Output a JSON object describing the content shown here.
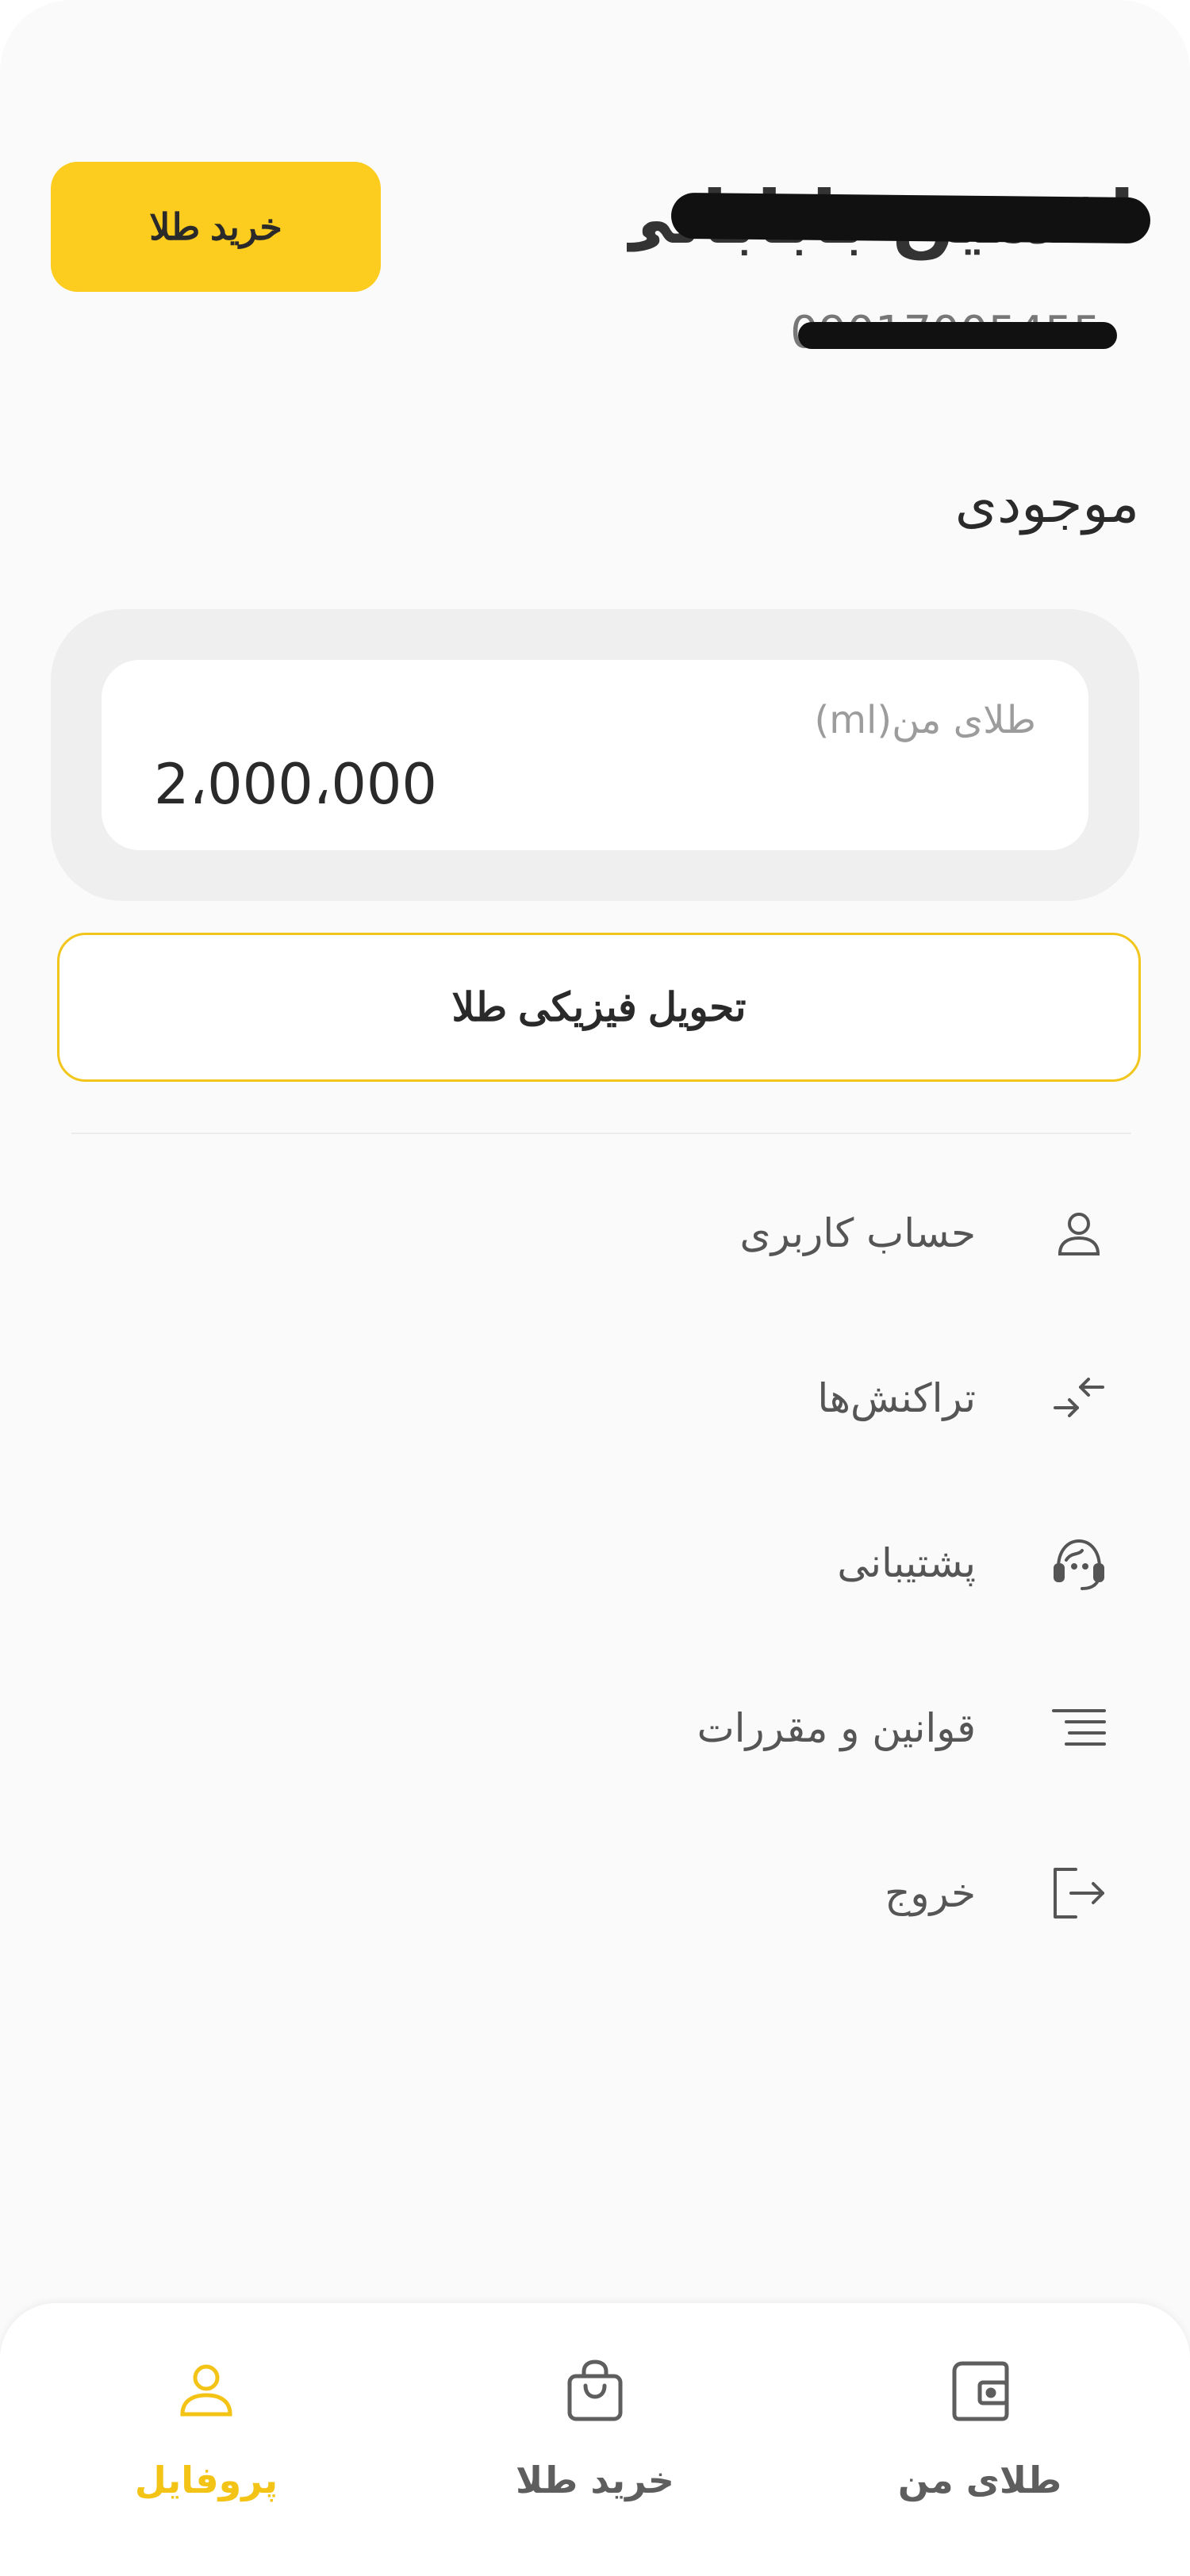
{
  "header": {
    "buy_button_label": "خرید طلا",
    "user_name": "افشین بابابانی",
    "user_phone": "09017005455"
  },
  "balance": {
    "title": "موجودی",
    "label": "طلای من(ml)",
    "value": "2،000،000"
  },
  "delivery_button_label": "تحویل فیزیکی طلا",
  "menu": {
    "items": [
      {
        "label": "حساب کاربری",
        "icon": "user-icon"
      },
      {
        "label": "تراکنش‌ها",
        "icon": "transactions-arrows-icon"
      },
      {
        "label": "پشتیبانی",
        "icon": "support-headset-icon"
      },
      {
        "label": "قوانین و مقررات",
        "icon": "rules-list-icon"
      },
      {
        "label": "خروج",
        "icon": "logout-icon"
      }
    ]
  },
  "bottom_nav": {
    "items": [
      {
        "label": "پروفایل",
        "icon": "profile-icon",
        "active": true
      },
      {
        "label": "خرید طلا",
        "icon": "shopping-bag-icon",
        "active": false
      },
      {
        "label": "طلای من",
        "icon": "wallet-icon",
        "active": false
      }
    ]
  },
  "colors": {
    "accent": "#fccc1e",
    "active_nav": "#f3c315",
    "background": "#fafafa"
  }
}
